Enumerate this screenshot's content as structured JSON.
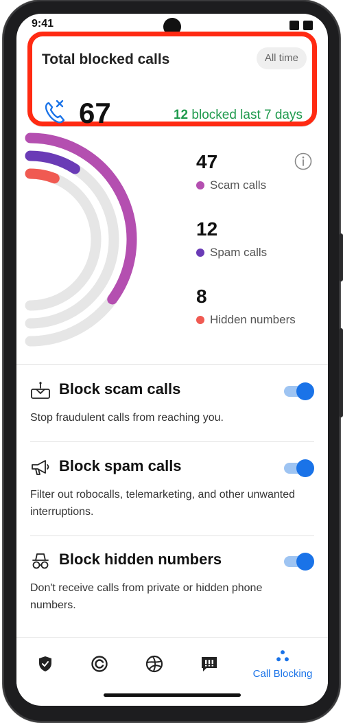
{
  "status_bar": {
    "time": "9:41"
  },
  "summary": {
    "title": "Total blocked calls",
    "filter_chip": "All time",
    "total": "67",
    "recent_count": "12",
    "recent_label": " blocked last 7 days",
    "colors": {
      "highlight_border": "#ff2a12",
      "recent_text": "#1f9a4d",
      "icon": "#1a73e8"
    }
  },
  "breakdown": {
    "items": [
      {
        "count": "47",
        "label": "Scam calls",
        "color": "#b44fb0",
        "share": 0.7
      },
      {
        "count": "12",
        "label": "Spam calls",
        "color": "#6a3bb6",
        "share": 0.18
      },
      {
        "count": "8",
        "label": "Hidden numbers",
        "color": "#f05a52",
        "share": 0.12
      }
    ],
    "track_color": "#e6e6e6"
  },
  "settings": [
    {
      "title": "Block scam calls",
      "description": "Stop fraudulent calls from reaching you.",
      "icon": "scam-alert-icon",
      "enabled": true
    },
    {
      "title": "Block spam calls",
      "description": "Filter out robocalls, telemarketing, and other unwanted interruptions.",
      "icon": "megaphone-icon",
      "enabled": true
    },
    {
      "title": "Block hidden numbers",
      "description": "Don't receive calls from private or hidden phone numbers.",
      "icon": "incognito-icon",
      "enabled": true
    }
  ],
  "bottom_nav": {
    "items": [
      {
        "icon": "shield-check-icon",
        "label": ""
      },
      {
        "icon": "web-protection-icon",
        "label": ""
      },
      {
        "icon": "ball-icon",
        "label": ""
      },
      {
        "icon": "message-alert-icon",
        "label": ""
      },
      {
        "icon": "call-blocking-icon",
        "label": "Call Blocking",
        "active": true
      }
    ],
    "active_color": "#1a73e8"
  }
}
